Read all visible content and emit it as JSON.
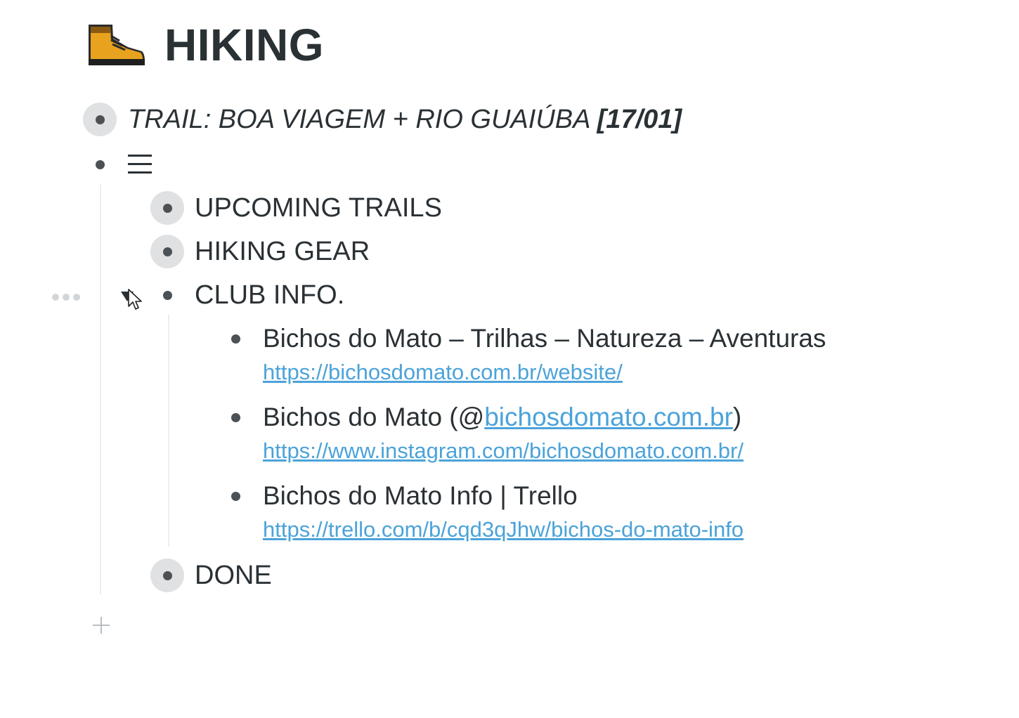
{
  "page": {
    "title": "HIKING",
    "icon": "hiking-boot-icon"
  },
  "outline": {
    "trail": {
      "label": "TRAIL: BOA VIAGEM + RIO GUAIÚBA ",
      "date": "[17/01]"
    },
    "menu_item": {
      "icon": "hamburger-icon"
    },
    "upcoming": {
      "label": "UPCOMING TRAILS"
    },
    "gear": {
      "label": "HIKING GEAR"
    },
    "club": {
      "label": "CLUB INFO.",
      "children": [
        {
          "label": "Bichos do Mato – Trilhas – Natureza – Aventuras",
          "note": "https://bichosdomato.com.br/website/"
        },
        {
          "label_prefix": "Bichos do Mato (@",
          "label_link": "bichosdomato.com.br",
          "label_suffix": ")",
          "note": "https://www.instagram.com/bichosdomato.com.br/"
        },
        {
          "label": "Bichos do Mato Info | Trello",
          "note": "https://trello.com/b/cqd3qJhw/bichos-do-mato-info"
        }
      ]
    },
    "done": {
      "label": "DONE"
    }
  },
  "colors": {
    "text": "#2a3135",
    "link": "#4ba3d9",
    "bullet_halo": "#dfe1e3"
  }
}
